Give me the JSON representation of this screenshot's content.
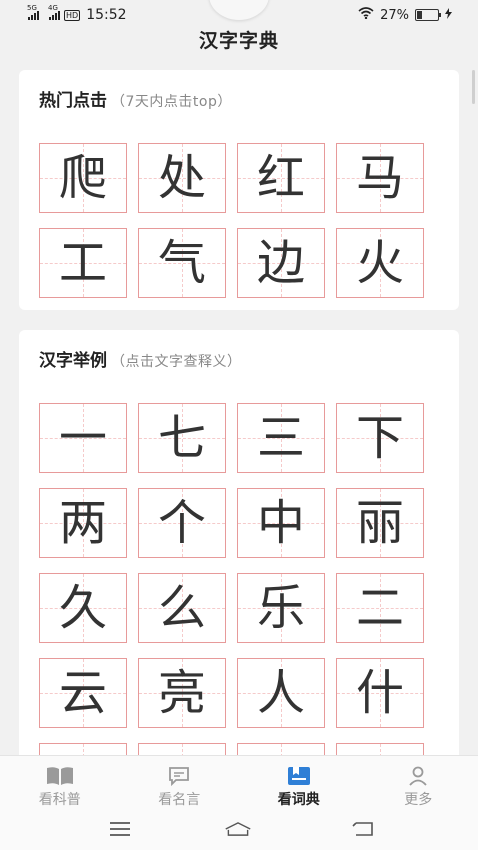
{
  "status_bar": {
    "network1": "5G",
    "network2": "4G",
    "hd": "HD",
    "time": "15:52",
    "battery_percent": "27%",
    "battery_level": 0.27
  },
  "header": {
    "title": "汉字字典"
  },
  "hot": {
    "title": "热门点击",
    "subtitle": "（7天内点击top）",
    "chars": [
      "爬",
      "处",
      "红",
      "马",
      "工",
      "气",
      "边",
      "火"
    ]
  },
  "examples": {
    "title": "汉字举例",
    "subtitle": "（点击文字查释义）",
    "chars": [
      "一",
      "七",
      "三",
      "下",
      "两",
      "个",
      "中",
      "丽",
      "久",
      "么",
      "乐",
      "二",
      "云",
      "亮",
      "人",
      "什",
      "",
      "",
      "",
      ""
    ]
  },
  "tabs": [
    {
      "label": "看科普",
      "icon": "book-icon"
    },
    {
      "label": "看名言",
      "icon": "quote-icon"
    },
    {
      "label": "看词典",
      "icon": "dictionary-icon"
    },
    {
      "label": "更多",
      "icon": "person-icon"
    }
  ],
  "active_tab": 2,
  "colors": {
    "cell_border": "#e79a9a",
    "active_tab": "#222222",
    "accent_icon": "#2f7fd6"
  }
}
